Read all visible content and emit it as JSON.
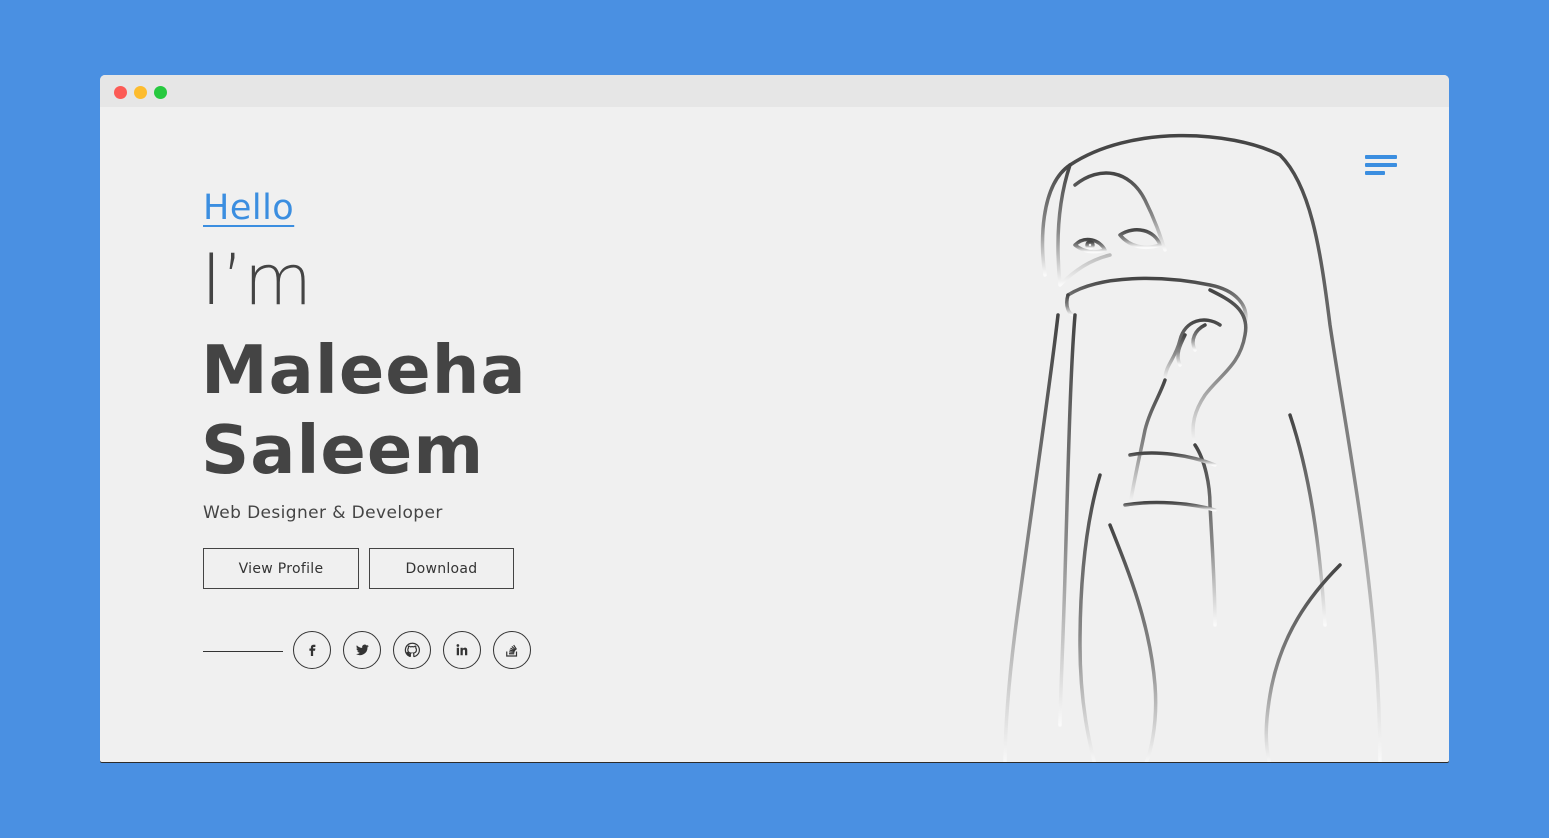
{
  "hero": {
    "greeting": "Hello",
    "intro": "I’m",
    "name_first": "Maleeha",
    "name_last": "Saleem",
    "role": "Web Designer & Developer"
  },
  "buttons": {
    "view_profile": "View Profile",
    "download": "Download"
  },
  "social": [
    "facebook-icon",
    "twitter-icon",
    "github-icon",
    "linkedin-icon",
    "stackoverflow-icon"
  ],
  "colors": {
    "background": "#4a90e2",
    "accent": "#3b8ee0",
    "text": "#444444",
    "page": "#f0f0f0"
  }
}
